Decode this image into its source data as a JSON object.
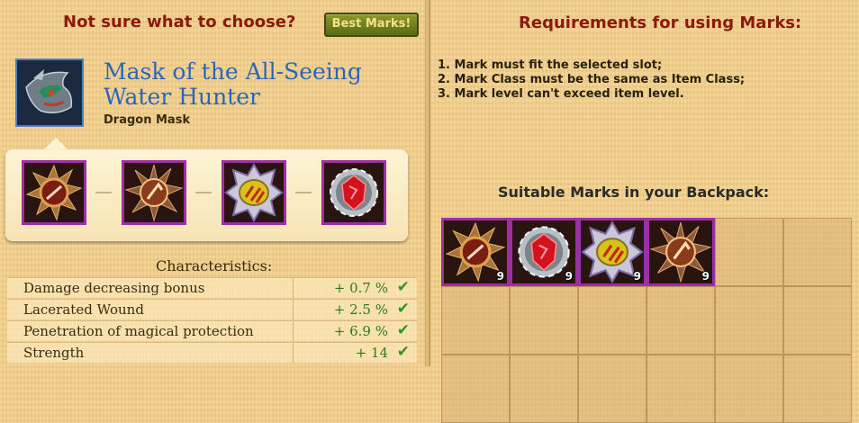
{
  "left": {
    "hint": "Not sure what to choose?",
    "best_marks_button": "Best Marks!",
    "item": {
      "name": "Mask of the All-Seeing Water Hunter",
      "type": "Dragon Mask",
      "icon": "dragon-mask-icon"
    },
    "slots": [
      {
        "icon": "bronze-spiked-mark-icon"
      },
      {
        "icon": "copper-star-mark-icon"
      },
      {
        "icon": "yellow-striped-mark-icon"
      },
      {
        "icon": "red-gear-mark-icon"
      }
    ],
    "characteristics_title": "Characteristics:",
    "stats": [
      {
        "name": "Damage decreasing bonus",
        "value": "+ 0.7 %"
      },
      {
        "name": "Lacerated Wound",
        "value": "+ 2.5 %"
      },
      {
        "name": "Penetration of magical protection",
        "value": "+ 6.9 %"
      },
      {
        "name": "Strength",
        "value": "+ 14"
      }
    ]
  },
  "right": {
    "title": "Requirements for using Marks:",
    "requirements": [
      "1. Mark must fit the selected slot;",
      "2. Mark Class must be the same as Item Class;",
      "3. Mark level can't exceed item level."
    ],
    "suitable_title": "Suitable Marks in your Backpack:",
    "backpack": [
      {
        "icon": "bronze-spiked-mark-icon",
        "count": "9"
      },
      {
        "icon": "red-gear-mark-icon",
        "count": "9"
      },
      {
        "icon": "yellow-striped-mark-icon",
        "count": "9"
      },
      {
        "icon": "copper-star-mark-icon",
        "count": "9"
      }
    ]
  },
  "colors": {
    "title_red": "#8b1a0c",
    "item_blue": "#2a65b8",
    "stat_green": "#2e7a1a",
    "slot_purple": "#9b2fa3"
  }
}
